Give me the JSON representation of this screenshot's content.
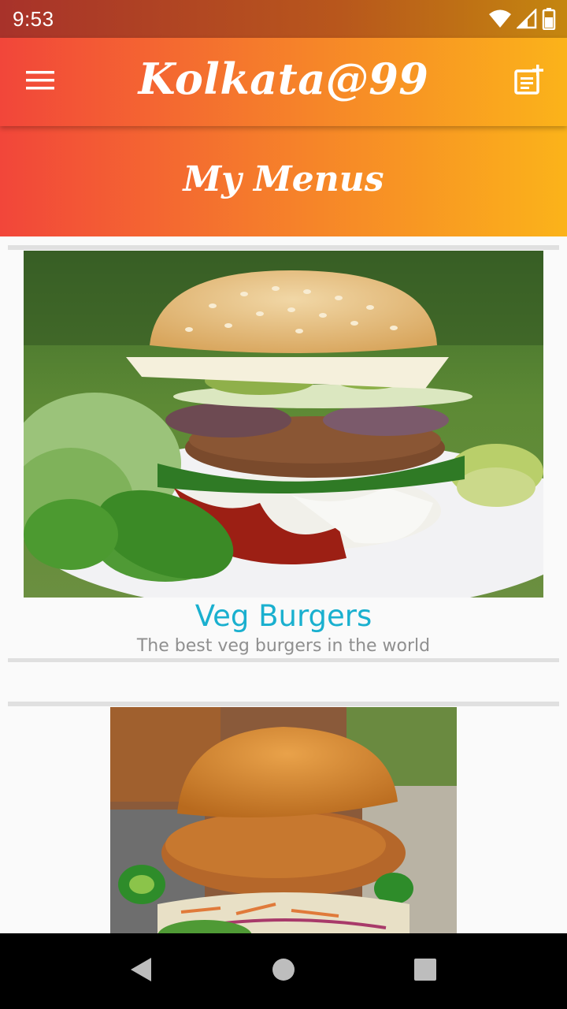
{
  "status_bar": {
    "time": "9:53",
    "icons": [
      "wifi-icon",
      "signal-icon",
      "battery-icon"
    ]
  },
  "app_bar": {
    "title": "Kolkata@99",
    "left_icon": "hamburger-menu-icon",
    "right_icon": "note-add-icon"
  },
  "header": {
    "title": "My Menus"
  },
  "menus": [
    {
      "title": "Veg Burgers",
      "subtitle": "The best veg burgers in the world",
      "image": "veg-burger-photo"
    },
    {
      "title": "",
      "subtitle": "",
      "image": "chicken-burger-photo"
    }
  ],
  "nav_bar": {
    "icons": [
      "back-icon",
      "home-icon",
      "recents-icon"
    ]
  },
  "colors": {
    "gradient_start": "#f2463a",
    "gradient_end": "#fbb31a",
    "title_accent": "#1ab0cf",
    "subtitle_gray": "#8f8f8f"
  }
}
